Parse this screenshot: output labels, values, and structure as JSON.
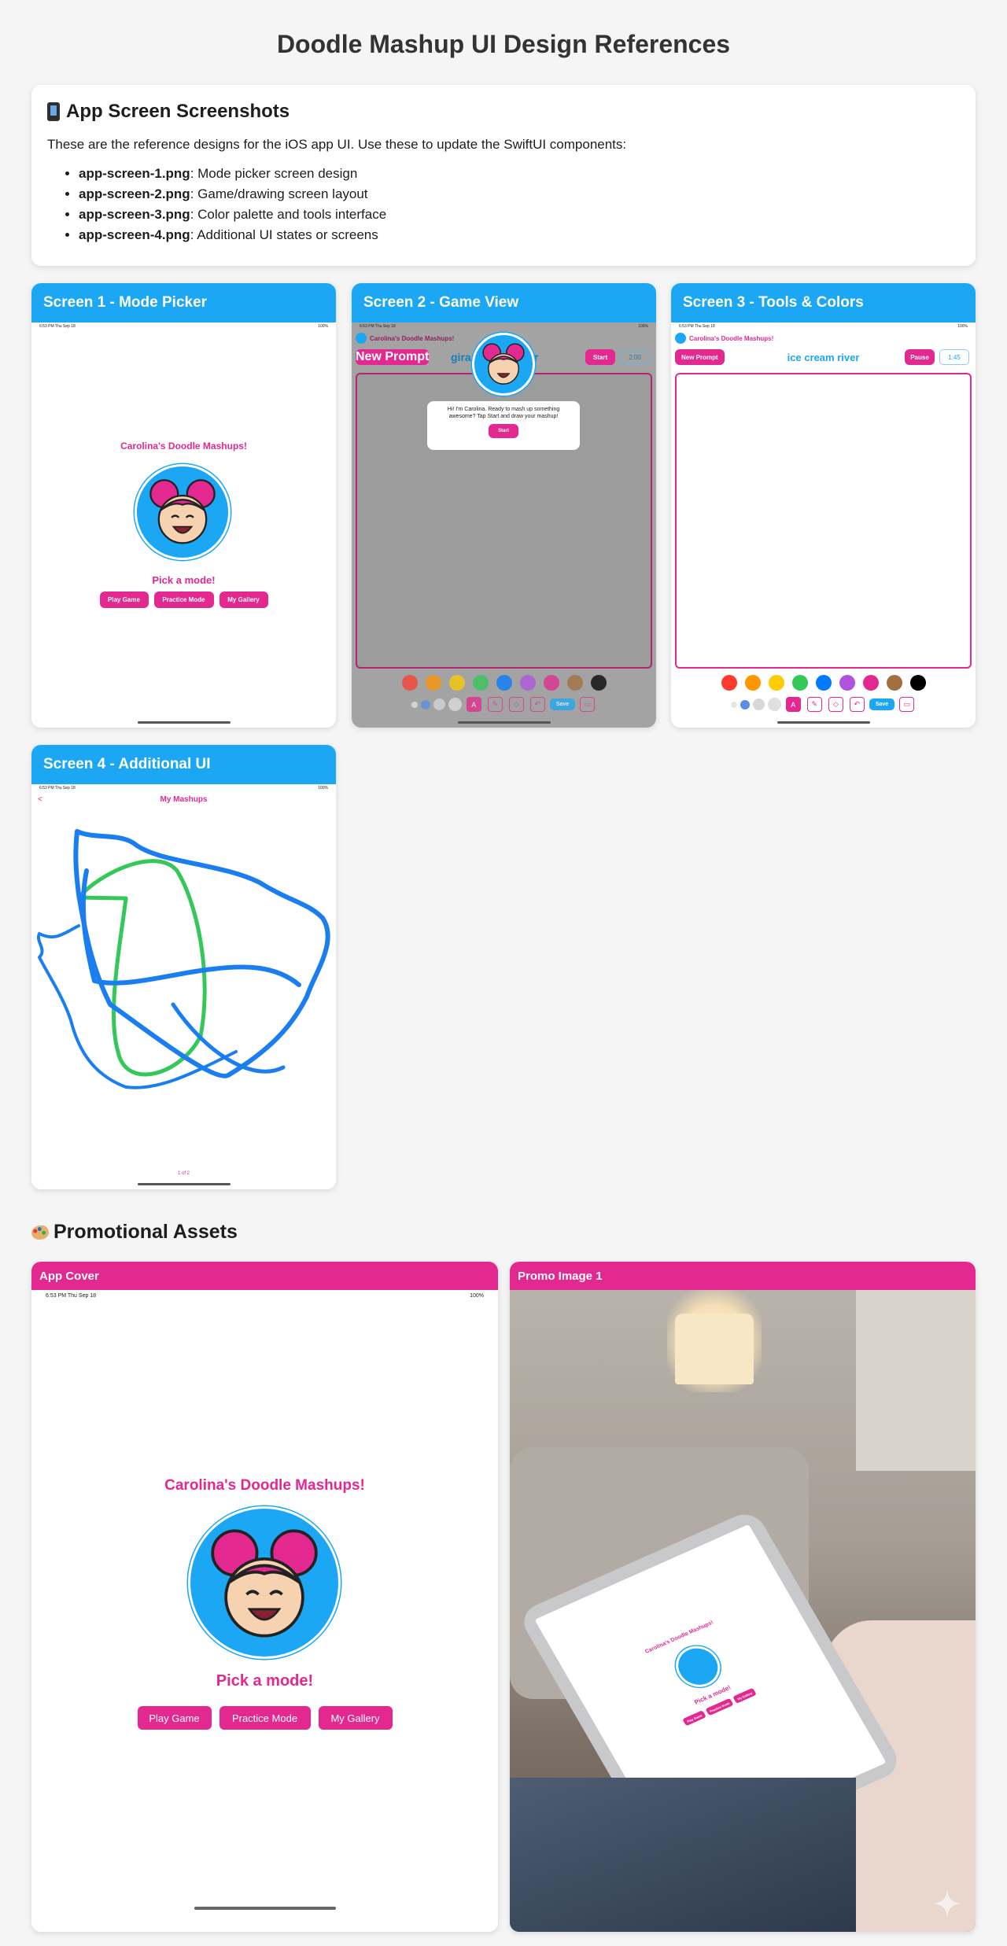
{
  "page_title": "Doodle Mashup UI Design References",
  "intro": {
    "icon": "phone-icon",
    "heading": "App Screen Screenshots",
    "description": "These are the reference designs for the iOS app UI. Use these to update the SwiftUI components:",
    "items": [
      {
        "file": "app-screen-1.png",
        "desc": ": Mode picker screen design"
      },
      {
        "file": "app-screen-2.png",
        "desc": ": Game/drawing screen layout"
      },
      {
        "file": "app-screen-3.png",
        "desc": ": Color palette and tools interface"
      },
      {
        "file": "app-screen-4.png",
        "desc": ": Additional UI states or screens"
      }
    ]
  },
  "screens": [
    {
      "title": "Screen 1 - Mode Picker"
    },
    {
      "title": "Screen 2 - Game View"
    },
    {
      "title": "Screen 3 - Tools & Colors"
    },
    {
      "title": "Screen 4 - Additional UI"
    }
  ],
  "app": {
    "status_time": "6:53 PM   Thu Sep 18",
    "status_battery": "100%",
    "name": "Carolina's Doodle Mashups!",
    "pick_mode": "Pick a mode!",
    "buttons": [
      "Play Game",
      "Practice Mode",
      "My Gallery"
    ],
    "new_prompt": "New Prompt",
    "start": "Start",
    "pause": "Pause",
    "save": "Save",
    "game_prompt_partial": "gira",
    "game_prompt_tail": "r",
    "timer_game": "2:00",
    "timer_tools": "1:45",
    "tools_prompt": "ice cream river",
    "dialog_text": "Hi! I'm Carolina. Ready to mash up something awesome? Tap Start and draw your mashup!",
    "dialog_button": "Start",
    "gallery_title": "My Mashups",
    "gallery_page": "1 of 2",
    "back": "<",
    "palette": [
      "#ff3b30",
      "#ff9500",
      "#ffcc00",
      "#34c759",
      "#007aff",
      "#af52de",
      "#e3288f",
      "#a2703f",
      "#000000"
    ],
    "brush_sizes": [
      "#e5e5e5",
      "#5b8de8",
      "#d8d8d8",
      "#e0e0e0"
    ]
  },
  "promo": {
    "icon": "palette-icon",
    "heading": "Promotional Assets",
    "cover_title": "App Cover",
    "promo_title": "Promo Image 1",
    "status_time": "6:53 PM   Thu Sep 18",
    "status_battery": "100%",
    "tablet_title": "Carolina's Doodle Mashups!",
    "tablet_pick": "Pick a mode!",
    "tablet_buttons": [
      "Play Game",
      "Practice Mode",
      "My Gallery"
    ]
  }
}
